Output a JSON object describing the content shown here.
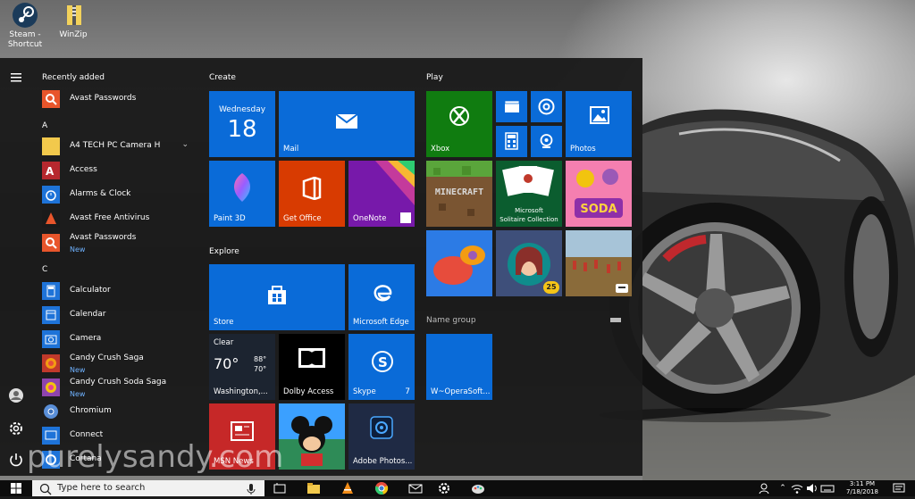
{
  "desktop": {
    "icons": [
      {
        "label_line1": "Steam -",
        "label_line2": "Shortcut",
        "icon": "steam-icon"
      },
      {
        "label_line1": "WinZip",
        "label_line2": "",
        "icon": "winzip-icon"
      }
    ]
  },
  "start_menu": {
    "recently_added_header": "Recently added",
    "recently_added": [
      {
        "name": "Avast Passwords",
        "color": "#e8552b"
      }
    ],
    "sections": [
      {
        "letter": "A",
        "apps": [
          {
            "name": "A4 TECH PC Camera H",
            "new": "",
            "color": "#f2c94c",
            "expandable": true
          },
          {
            "name": "Access",
            "new": "",
            "color": "#b7282e"
          },
          {
            "name": "Alarms & Clock",
            "new": "",
            "color": "#1e73d8"
          },
          {
            "name": "Avast Free Antivirus",
            "new": "",
            "color": "#e8552b"
          },
          {
            "name": "Avast Passwords",
            "new": "New",
            "color": "#e8552b"
          }
        ]
      },
      {
        "letter": "C",
        "apps": [
          {
            "name": "Calculator",
            "new": "",
            "color": "#1e73d8"
          },
          {
            "name": "Calendar",
            "new": "",
            "color": "#1e73d8"
          },
          {
            "name": "Camera",
            "new": "",
            "color": "#1e73d8"
          },
          {
            "name": "Candy Crush Saga",
            "new": "New",
            "color": "#c0392b"
          },
          {
            "name": "Candy Crush Soda Saga",
            "new": "New",
            "color": "#8e44ad"
          },
          {
            "name": "Chromium",
            "new": "",
            "color": "#3b7bd1"
          },
          {
            "name": "Connect",
            "new": "",
            "color": "#1e73d8"
          },
          {
            "name": "Cortana",
            "new": "",
            "color": "#1e73d8"
          }
        ]
      }
    ],
    "groups": {
      "create": "Create",
      "explore": "Explore",
      "play": "Play",
      "name_group": "Name group"
    },
    "tiles": {
      "calendar_day": "Wednesday",
      "calendar_date": "18",
      "mail": "Mail",
      "paint3d": "Paint 3D",
      "getoffice": "Get Office",
      "onenote": "OneNote",
      "store": "Store",
      "edge": "Microsoft Edge",
      "weather_cond": "Clear",
      "weather_temp": "70°",
      "weather_hi": "88°",
      "weather_lo": "70°",
      "weather_city": "Washington,...",
      "dolby": "Dolby Access",
      "skype": "Skype",
      "skype_badge": "7",
      "msn": "MSN News",
      "photoshop": "Adobe Photos...",
      "xbox": "Xbox",
      "photos": "Photos",
      "minecraft": "MINECRAFT",
      "solitaire_line1": "Microsoft",
      "solitaire_line2": "Solitaire Collection",
      "soda": "SODA",
      "opera": "W~OperaSoft...",
      "hidden_count": "25"
    }
  },
  "taskbar": {
    "search_placeholder": "Type here to search",
    "clock_time": "3:11 PM",
    "clock_date": "7/18/2018"
  },
  "watermark": "purelysandy.com",
  "colors": {
    "tile_blue": "#0a6bd8",
    "xbox_green": "#107c10",
    "office_red": "#d83b01",
    "onenote_purple": "#7719aa",
    "menu_bg": "#1a1a1a"
  }
}
